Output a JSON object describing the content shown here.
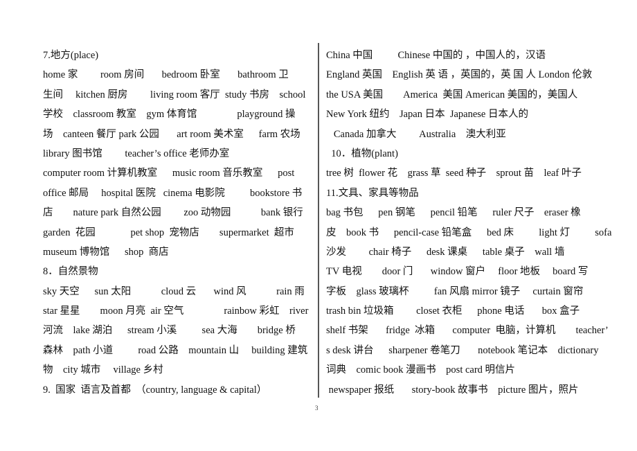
{
  "left_column": {
    "lines": [
      "7.地方(place)",
      "home 家         room 房间       bedroom 卧室       bathroom 卫",
      "生间     kitchen 厨房         living room 客厅  study 书房    school",
      "学校    classroom 教室    gym 体育馆                playground 操",
      "场    canteen 餐厅 park 公园       art room 美术室      farm 农场",
      "library 图书馆         teacher’s office 老师办室",
      "computer room 计算机教室      music room 音乐教室      post",
      "office 邮局     hospital 医院   cinema 电影院          bookstore 书",
      "店        nature park 自然公园         zoo 动物园            bank 银行",
      "garden  花园              pet shop  宠物店        supermarket  超市",
      "museum 博物馆      shop  商店",
      "8．自然景物",
      "sky 天空      sun 太阳            cloud 云       wind 风            rain 雨",
      "star 星星        moon 月亮  air 空气                rainbow 彩虹    river",
      "河流    lake 湖泊      stream 小溪          sea 大海        bridge 桥",
      "森林    path 小道          road 公路    mountain 山     building 建筑",
      "物    city 城市     village 乡村",
      "9.  国家  语言及首都  （country, language & capital）"
    ]
  },
  "right_column": {
    "lines": [
      "China 中国          Chinese 中国的 ，中国人的，汉语",
      "England 英国    English 英 语 ，英国的，英 国 人 London 伦敦",
      "the USA 美国        America  美国 American 美国的，美国人",
      "New York 纽约    Japan 日本  Japanese 日本人的",
      "   Canada 加拿大         Australia    澳大利亚",
      "  10．植物(plant)",
      "tree 树  flower 花    grass 草  seed 种子    sprout 苗    leaf 叶子",
      "11.文具、家具等物品",
      "bag 书包      pen 钢笔      pencil 铅笔      ruler 尺子    eraser 橡",
      "皮    book 书      pencil-case 铅笔盒      bed 床          light 灯          sofa",
      "沙发         chair 椅子      desk 课桌      table 桌子    wall 墙",
      "TV 电视        door 门       window 窗户     floor 地板     board 写",
      "字板    glass 玻璃杯          fan 风扇 mirror 镜子     curtain 窗帘",
      "trash bin 垃圾箱         closet 衣柜      phone 电话       box 盒子",
      "shelf 书架       fridge  冰箱       computer  电脑，计算机        teacher’",
      "s desk 讲台      sharpener 卷笔刀       notebook 笔记本    dictionary",
      "词典    comic book 漫画书    post card 明信片",
      " newspaper 报纸       story-book 故事书    picture 图片，照片"
    ]
  },
  "footer": {
    "page_number": "3"
  }
}
